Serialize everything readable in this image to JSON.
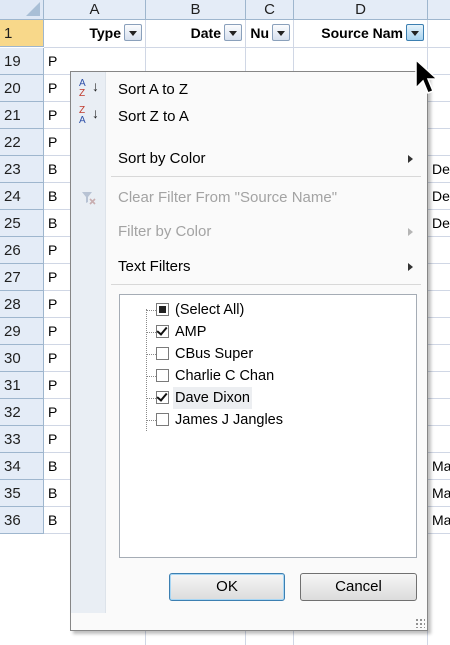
{
  "columns": [
    "A",
    "B",
    "C",
    "D"
  ],
  "header_row_number": "1",
  "header_cells": {
    "a": "Type",
    "b": "Date",
    "c": "Nu",
    "d": "Source Nam"
  },
  "row_numbers": [
    "19",
    "20",
    "21",
    "22",
    "23",
    "24",
    "25",
    "26",
    "27",
    "28",
    "29",
    "30",
    "31",
    "32",
    "33",
    "34",
    "35",
    "36"
  ],
  "column_a_letters": [
    "P",
    "P",
    "P",
    "P",
    "B",
    "B",
    "B",
    "P",
    "P",
    "P",
    "P",
    "P",
    "P",
    "P",
    "P",
    "B",
    "B",
    "B"
  ],
  "column_e_text": {
    "r23": "De",
    "r24": "De",
    "r25": "De",
    "r34": "Ma",
    "r35": "Ma",
    "r36": "Ma"
  },
  "menu": {
    "sort_az": "Sort A to Z",
    "sort_za": "Sort Z to A",
    "sort_by_color": "Sort by Color",
    "clear_filter": "Clear Filter From \"Source Name\"",
    "filter_by_color": "Filter by Color",
    "text_filters": "Text Filters",
    "sort_icon_a": "A",
    "sort_icon_z": "Z"
  },
  "filter_list": [
    {
      "label": "(Select All)",
      "state": "partial"
    },
    {
      "label": "AMP",
      "state": "checked"
    },
    {
      "label": "CBus Super",
      "state": "unchecked"
    },
    {
      "label": "Charlie C Chan",
      "state": "unchecked"
    },
    {
      "label": "Dave Dixon",
      "state": "checked"
    },
    {
      "label": "James J Jangles",
      "state": "unchecked"
    }
  ],
  "buttons": {
    "ok": "OK",
    "cancel": "Cancel"
  },
  "colors": {
    "header_bg": "#e4ecf7",
    "selected_row_header": "#f8d88a",
    "gridline": "#d0d7e5",
    "menu_gutter": "#e9eef4"
  }
}
